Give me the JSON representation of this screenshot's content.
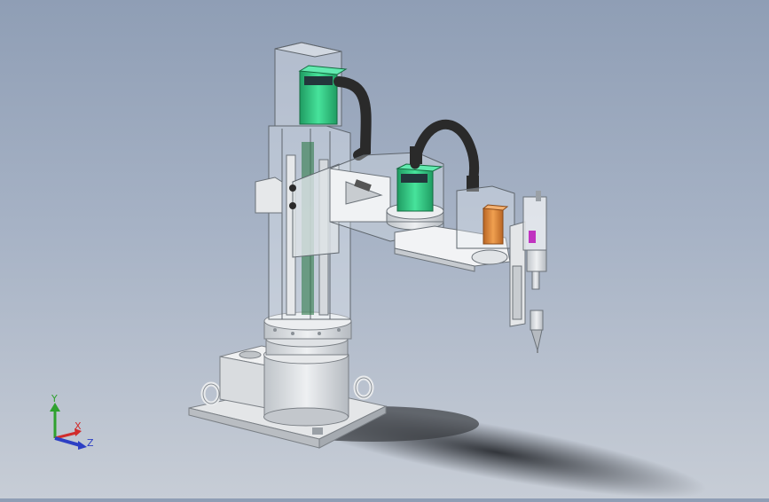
{
  "viewport": {
    "description_icon": "cad-3d-model-viewport",
    "colors": {
      "bg_top": "#8f9eb5",
      "bg_bottom": "#c7cdd6",
      "motor_green": "#35d08a",
      "motor_green_dark": "#1f9c62",
      "servo_orange": "#e08a3a",
      "metal_light": "#e6e8ea",
      "metal_mid": "#c8ccd0",
      "cable_black": "#2a2a2a",
      "accent_magenta": "#c033c0",
      "axis_x": "#d12c2c",
      "axis_y": "#2fa12f",
      "axis_z": "#2c3fc4"
    }
  },
  "triad": {
    "x_label": "X",
    "y_label": "Y",
    "z_label": "Z"
  }
}
